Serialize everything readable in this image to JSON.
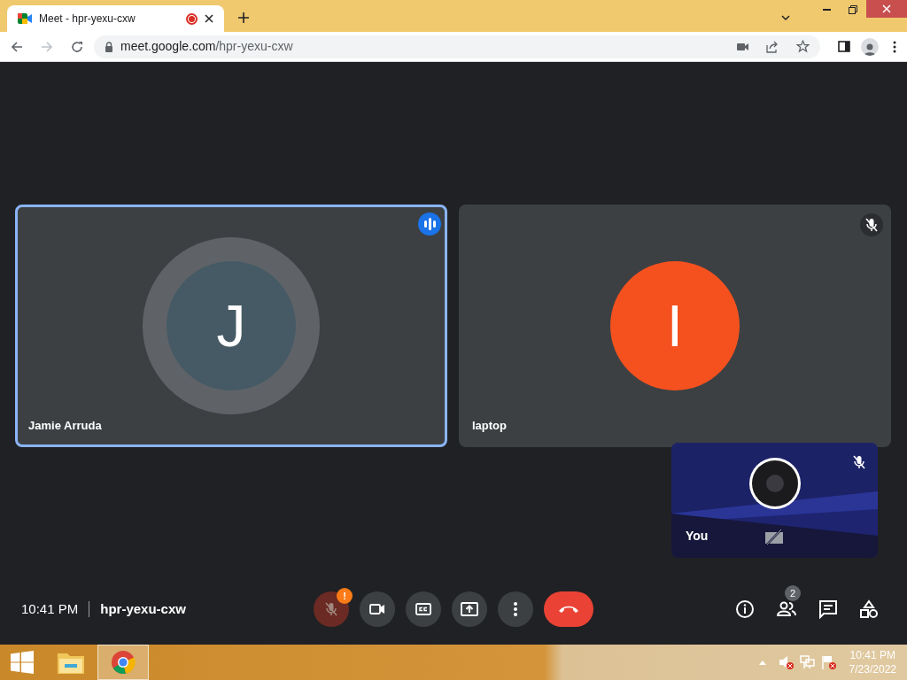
{
  "browser": {
    "tab_title": "Meet - hpr-yexu-cxw",
    "recording": true,
    "url_host": "meet.google.com",
    "url_path": "/hpr-yexu-cxw"
  },
  "tiles": [
    {
      "name": "Jamie Arruda",
      "initial": "J",
      "color": "#455a64",
      "speaking": true,
      "muted": false
    },
    {
      "name": "laptop",
      "initial": "I",
      "color": "#f4511e",
      "speaking": false,
      "muted": true
    }
  ],
  "self_view": {
    "name": "You",
    "muted": true,
    "camera_off": true
  },
  "meeting_bar": {
    "time": "10:41 PM",
    "code": "hpr-yexu-cxw",
    "mic_muted": true,
    "mic_alert": "!",
    "people_count": "2"
  },
  "taskbar": {
    "time": "10:41 PM",
    "date": "7/23/2022"
  }
}
